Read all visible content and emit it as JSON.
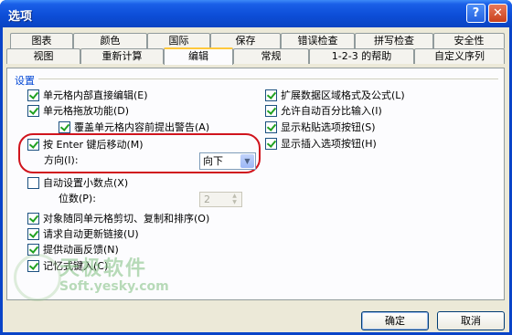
{
  "window": {
    "title": "选项",
    "help_label": "?",
    "close_label": "✕"
  },
  "tabs_row1": [
    "图表",
    "颜色",
    "国际",
    "保存",
    "错误检查",
    "拼写检查",
    "安全性"
  ],
  "tabs_row2": [
    "视图",
    "重新计算",
    "编辑",
    "常规",
    "1-2-3 的帮助",
    "自定义序列"
  ],
  "active_tab": "编辑",
  "section": {
    "label": "设置"
  },
  "options_left": [
    {
      "label": "单元格内部直接编辑(E)",
      "checked": true
    },
    {
      "label": "单元格拖放功能(D)",
      "checked": true
    },
    {
      "label": "覆盖单元格内容前提出警告(A)",
      "checked": true
    },
    {
      "label": "按 Enter 键后移动(M)",
      "checked": true
    },
    {
      "label": "自动设置小数点(X)",
      "checked": false
    },
    {
      "label": "对象随同单元格剪切、复制和排序(O)",
      "checked": true
    },
    {
      "label": "请求自动更新链接(U)",
      "checked": true
    },
    {
      "label": "提供动画反馈(N)",
      "checked": true
    },
    {
      "label": "记忆式键入(C)",
      "checked": true
    }
  ],
  "options_right": [
    {
      "label": "扩展数据区域格式及公式(L)",
      "checked": true
    },
    {
      "label": "允许自动百分比输入(I)",
      "checked": true
    },
    {
      "label": "显示粘贴选项按钮(S)",
      "checked": true
    },
    {
      "label": "显示插入选项按钮(H)",
      "checked": true
    }
  ],
  "direction": {
    "label": "方向(I):",
    "value": "向下"
  },
  "decimals": {
    "label": "位数(P):",
    "value": "2"
  },
  "watermark": {
    "line1": "天极软件",
    "line2": "Soft.yesky.com"
  },
  "buttons": {
    "ok": "确定",
    "cancel": "取消"
  }
}
